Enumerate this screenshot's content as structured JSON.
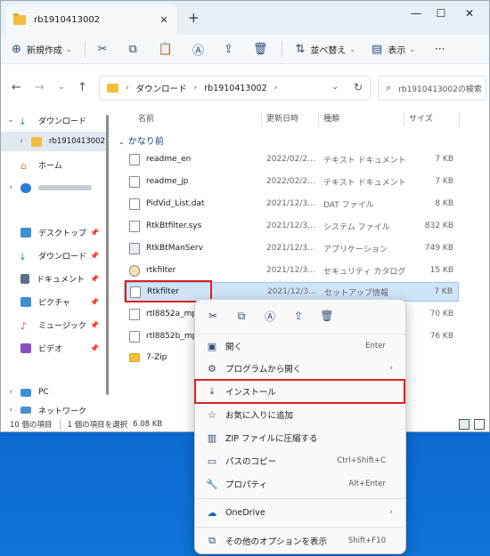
{
  "window": {
    "tab_title": "rb1910413002",
    "tab_close": "✕",
    "new_tab": "+",
    "minimize": "—",
    "maximize": "☐",
    "close": "✕"
  },
  "toolbar": {
    "new_label": "新規作成",
    "sort_label": "並べ替え",
    "view_label": "表示",
    "more": "···"
  },
  "address": {
    "crumbs": [
      "ダウンロード",
      "rb1910413002"
    ],
    "search_placeholder": "rb1910413002の検索"
  },
  "sidebar": {
    "downloads": "ダウンロード",
    "current_folder": "rb1910413002",
    "home": "ホーム",
    "desktop": "デスクトップ",
    "downloads2": "ダウンロード",
    "documents": "ドキュメント",
    "pictures": "ピクチャ",
    "music": "ミュージック",
    "videos": "ビデオ",
    "pc": "PC",
    "network": "ネットワーク"
  },
  "columns": {
    "name": "名前",
    "date": "更新日時",
    "type": "種類",
    "size": "サイズ"
  },
  "group_label": "かなり前",
  "files": [
    {
      "name": "readme_en",
      "date": "2022/02/2...",
      "type": "テキスト ドキュメント",
      "size": "7 KB"
    },
    {
      "name": "readme_jp",
      "date": "2022/02/2...",
      "type": "テキスト ドキュメント",
      "size": "7 KB"
    },
    {
      "name": "PidVid_List.dat",
      "date": "2021/12/3...",
      "type": "DAT ファイル",
      "size": "8 KB"
    },
    {
      "name": "RtkBtfilter.sys",
      "date": "2021/12/3...",
      "type": "システム ファイル",
      "size": "832 KB"
    },
    {
      "name": "RtkBtManServ",
      "date": "2021/12/3...",
      "type": "アプリケーション",
      "size": "749 KB"
    },
    {
      "name": "rtkfilter",
      "date": "2021/12/3...",
      "type": "セキュリティ カタログ",
      "size": "15 KB"
    },
    {
      "name": "Rtkfilter",
      "date": "2021/12/3...",
      "type": "セットアップ情報",
      "size": "7 KB"
    },
    {
      "name": "rtl8852a_mp_c",
      "date": "",
      "type": "",
      "size": "70 KB"
    },
    {
      "name": "rtl8852b_mp_c",
      "date": "",
      "type": "",
      "size": "76 KB"
    },
    {
      "name": "7-Zip",
      "date": "",
      "type": "",
      "size": ""
    }
  ],
  "status": {
    "count": "10 個の項目",
    "selection": "1 個の項目を選択",
    "size": "6.08 KB"
  },
  "context_menu": {
    "open": "開く",
    "open_shortcut": "Enter",
    "open_with": "プログラムから開く",
    "install": "インストール",
    "favorite": "お気に入りに追加",
    "zip": "ZIP ファイルに圧縮する",
    "copy_path": "パスのコピー",
    "copy_path_shortcut": "Ctrl+Shift+C",
    "properties": "プロパティ",
    "properties_shortcut": "Alt+Enter",
    "onedrive": "OneDrive",
    "more_options": "その他のオプションを表示",
    "more_options_shortcut": "Shift+F10"
  },
  "colors": {
    "accent": "#0067c0",
    "highlight_box": "#e0201e",
    "selected_row": "#cfe4f8",
    "folder": "#f2bf3c"
  }
}
